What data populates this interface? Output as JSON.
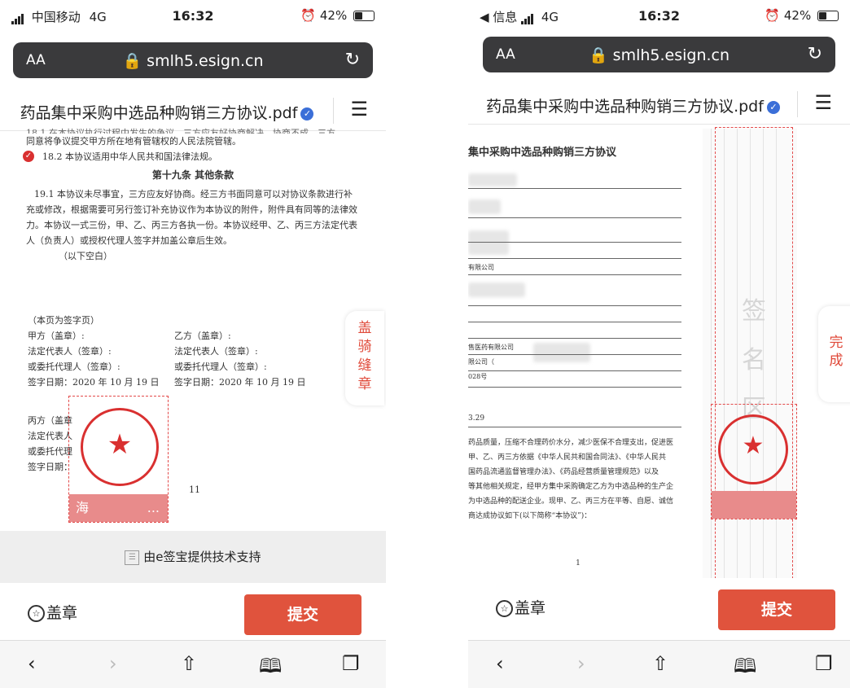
{
  "left": {
    "status": {
      "carrier": "中国移动",
      "network": "4G",
      "time": "16:32",
      "battery": "42%"
    },
    "url": {
      "aa": "AA",
      "host": "smlh5.esign.cn"
    },
    "doc_title": "药品集中采购中选品种购销三方协议.pdf",
    "document": {
      "line_top": "18.1 在本协议执行过程中发生的争议，三方应友好协商解决，协商不成，三方",
      "line_18_1b": "同意将争议提交甲方所在地有管辖权的人民法院管辖。",
      "line_18_2": "18.2 本协议适用中华人民共和国法律法规。",
      "heading": "第十九条 其他条款",
      "para_19_1": [
        "19.1 本协议未尽事宜，三方应友好协商。经三方书面同意可以对协议条款进行补",
        "充或修改，根据需要可另行签订补充协议作为本协议的附件，附件具有同等的法律效",
        "力。本协议一式三份，甲、乙、丙三方各执一份。本协议经甲、乙、丙三方法定代表",
        "人（负责人）或授权代理人签字并加盖公章后生效。"
      ],
      "blank_note": "（以下空白）",
      "sign_page": "（本页为签字页）",
      "party_a": "甲方（盖章）:",
      "party_b": "乙方（盖章）:",
      "legal_a": "法定代表人（签章）:",
      "legal_b": "法定代表人（签章）:",
      "agent_a": "或委托代理人（签章）:",
      "agent_b": "或委托代理人（签章）:",
      "date_a": "签字日期：2020 年 10 月 19 日",
      "date_b": "签字日期：2020 年 10 月 19 日",
      "party_c": "丙方（盖章",
      "legal_c": "法定代表人",
      "agent_c": "或委托代理",
      "date_c": "签字日期：",
      "page_num": "11"
    },
    "seal_label": "海",
    "seal_label_end": "...",
    "side_button": "盖骑缝章",
    "support": "由e签宝提供技术支持",
    "stamp_button": "盖章",
    "submit_button": "提交"
  },
  "right": {
    "status": {
      "back": "◀ 信息",
      "network": "4G",
      "time": "16:32",
      "battery": "42%"
    },
    "url": {
      "aa": "AA",
      "host": "smlh5.esign.cn"
    },
    "doc_title": "药品集中采购中选品种购销三方协议.pdf",
    "document": {
      "heading": "集中采购中选品种购销三方协议",
      "frag_company": "有限公司",
      "frag_1": "售医药有限公司",
      "frag_2": "限公司（",
      "frag_3": "028号",
      "frag_4": "3.29",
      "body": [
        "药品质量，压缩不合理药价水分，减少医保不合理支出，促进医",
        "甲、乙、丙三方依据《中华人民共和国合同法》、《中华人民共",
        "国药品流通监督管理办法》、《药品经营质量管理规范》以及",
        "等其他相关规定，经甲方集中采购确定乙方为中选品种的生产企",
        "为中选品种的配送企业。现甲、乙、丙三方在平等、自愿、诚信",
        "商达成协议如下(以下简称“本协议”)："
      ],
      "page_num": "1"
    },
    "sign_area": "签名区",
    "done_button": "完成",
    "stamp_button": "盖章",
    "submit_button": "提交"
  },
  "colors": {
    "accent": "#e0533d",
    "seal": "#d93030",
    "verified": "#3b6fd8"
  },
  "icons": [
    "lock-icon",
    "reload-icon",
    "menu-icon",
    "verified-icon",
    "back-icon",
    "forward-icon",
    "share-icon",
    "bookmarks-icon",
    "tabs-icon",
    "stamp-icon",
    "support-logo-icon"
  ]
}
